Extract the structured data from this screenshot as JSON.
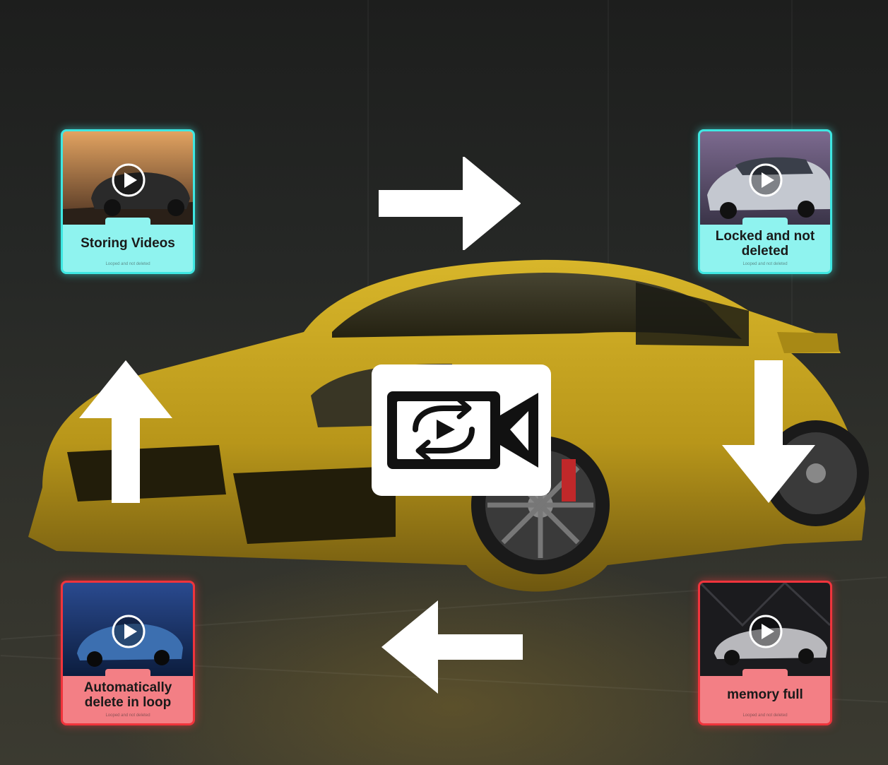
{
  "cards": {
    "storing": {
      "title": "Storing Videos",
      "caption": "Looped and not deleted",
      "icon": "play-icon"
    },
    "locked": {
      "title": "Locked and not deleted",
      "caption": "Looped and not deleted",
      "icon": "play-icon"
    },
    "memory": {
      "title": "memory full",
      "caption": "Looped and not deleted",
      "icon": "play-icon"
    },
    "auto": {
      "title": "Automatically delete in loop",
      "caption": "Looped and not deleted",
      "icon": "play-icon"
    }
  },
  "center": {
    "icon": "loop-recording-camera-icon"
  },
  "colors": {
    "cyan_card": "#8ff3ef",
    "cyan_border": "#3ee7e2",
    "red_card": "#f37f85",
    "red_border": "#f0343c",
    "car": "#c9a21c"
  }
}
